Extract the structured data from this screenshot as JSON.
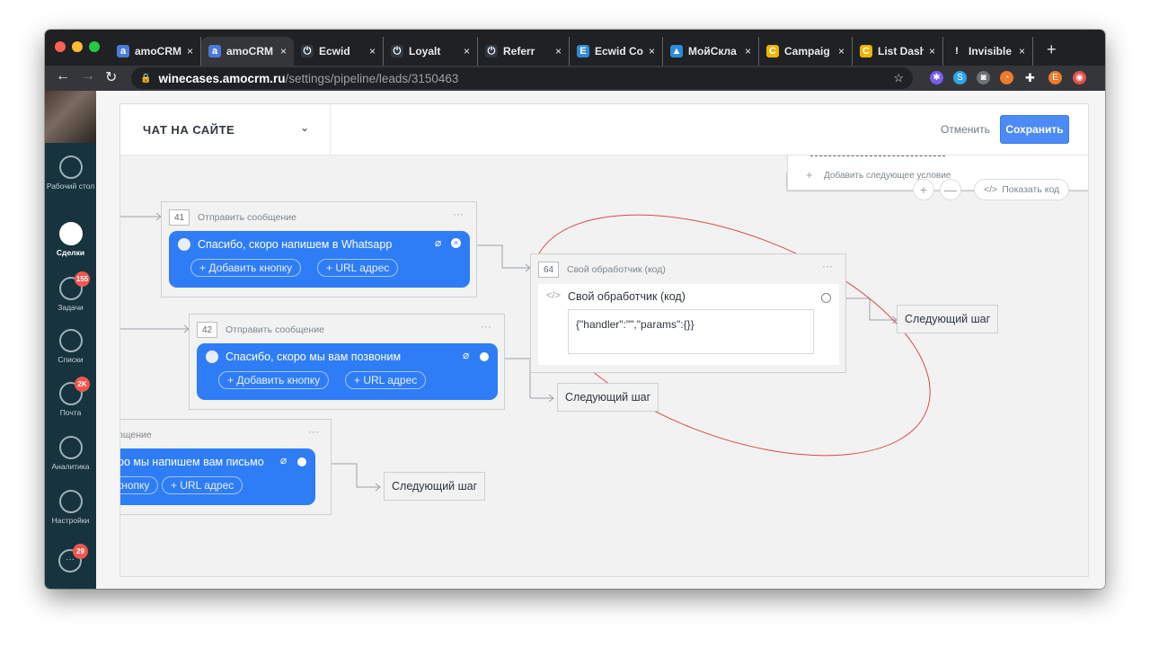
{
  "browser": {
    "tabs": [
      {
        "title": "amoCRM",
        "icon": "amocrm-icon",
        "color": "#4a7bd6",
        "glyph": "a"
      },
      {
        "title": "amoCRM",
        "icon": "amocrm-icon",
        "color": "#4a7bd6",
        "glyph": "a"
      },
      {
        "title": "Ecwid",
        "icon": "power-icon",
        "color": "#2e3640",
        "glyph": "⏻"
      },
      {
        "title": "Loyalt",
        "icon": "power-icon",
        "color": "#2e3640",
        "glyph": "⏻"
      },
      {
        "title": "Referr",
        "icon": "power-icon",
        "color": "#2e3640",
        "glyph": "⏻"
      },
      {
        "title": "Ecwid Co",
        "icon": "ecwid-icon",
        "color": "#2f8bd8",
        "glyph": "E"
      },
      {
        "title": "МойСкла",
        "icon": "moysklad-icon",
        "color": "#2f8bd8",
        "glyph": "▲"
      },
      {
        "title": "Campaig",
        "icon": "campaign-icon",
        "color": "#f0b400",
        "glyph": "C"
      },
      {
        "title": "List Dash",
        "icon": "list-dash-icon",
        "color": "#f0b400",
        "glyph": "C"
      },
      {
        "title": "Invisible",
        "icon": "exclamation-icon",
        "color": "#202124",
        "glyph": "!"
      }
    ],
    "url_host": "winecases.amocrm.ru",
    "url_path": "/settings/pipeline/leads/3150463"
  },
  "sidebar": {
    "items": [
      {
        "label": "Рабочий стол",
        "icon": "dashboard-icon",
        "badge": ""
      },
      {
        "label": "Сделки",
        "icon": "deals-icon",
        "badge": ""
      },
      {
        "label": "Задачи",
        "icon": "tasks-icon",
        "badge": "155"
      },
      {
        "label": "Списки",
        "icon": "lists-icon",
        "badge": ""
      },
      {
        "label": "Почта",
        "icon": "mail-icon",
        "badge": "2K"
      },
      {
        "label": "Аналитика",
        "icon": "analytics-icon",
        "badge": ""
      },
      {
        "label": "Настройки",
        "icon": "settings-icon",
        "badge": ""
      }
    ],
    "chat_badge": "29"
  },
  "modal": {
    "title": "ЧАТ НА САЙТЕ",
    "cancel_label": "Отменить",
    "save_label": "Сохранить"
  },
  "canvas": {
    "top_right": {
      "add_condition": "Добавить следующее условие",
      "show_code": "Показать код",
      "zoom_in": "+",
      "zoom_out": "—"
    },
    "card41": {
      "num": "41",
      "title": "Отправить сообщение",
      "message": "Спасибо, скоро напишем в Whatsapp",
      "add_button": "+ Добавить кнопку",
      "url_button": "+ URL адрес"
    },
    "card42": {
      "num": "42",
      "title": "Отправить сообщение",
      "message": "Спасибо, скоро мы вам позвоним",
      "add_button": "+ Добавить кнопку",
      "url_button": "+ URL адрес"
    },
    "card3": {
      "title": "ощение",
      "message": "ро мы напишем вам письмо",
      "add_button": "кнопку",
      "url_button": "+ URL адрес"
    },
    "card64": {
      "num": "64",
      "title": "Свой обработчик (код)",
      "handler_label": "Свой обработчик (код)",
      "code": "{\"handler\":\"\",\"params\":{}}"
    },
    "next_step": "Следующий шаг"
  }
}
